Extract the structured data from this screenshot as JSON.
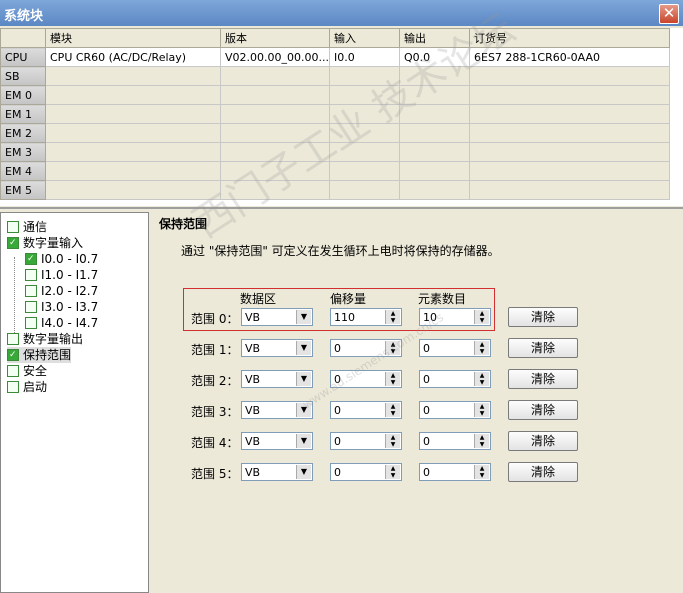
{
  "window": {
    "title": "系统块",
    "close_glyph": "✕"
  },
  "grid": {
    "headers": [
      "",
      "模块",
      "版本",
      "输入",
      "输出",
      "订货号"
    ],
    "rows": [
      {
        "label": "CPU",
        "module": "CPU CR60 (AC/DC/Relay)",
        "version": "V02.00.00_00.00...",
        "input": "I0.0",
        "output": "Q0.0",
        "order": "6ES7 288-1CR60-0AA0"
      },
      {
        "label": "SB",
        "module": "",
        "version": "",
        "input": "",
        "output": "",
        "order": ""
      },
      {
        "label": "EM 0",
        "module": "",
        "version": "",
        "input": "",
        "output": "",
        "order": ""
      },
      {
        "label": "EM 1",
        "module": "",
        "version": "",
        "input": "",
        "output": "",
        "order": ""
      },
      {
        "label": "EM 2",
        "module": "",
        "version": "",
        "input": "",
        "output": "",
        "order": ""
      },
      {
        "label": "EM 3",
        "module": "",
        "version": "",
        "input": "",
        "output": "",
        "order": ""
      },
      {
        "label": "EM 4",
        "module": "",
        "version": "",
        "input": "",
        "output": "",
        "order": ""
      },
      {
        "label": "EM 5",
        "module": "",
        "version": "",
        "input": "",
        "output": "",
        "order": ""
      }
    ]
  },
  "tree": {
    "items": [
      {
        "label": "通信",
        "checked": false,
        "level": 0
      },
      {
        "label": "数字量输入",
        "checked": true,
        "level": 0
      },
      {
        "label": "I0.0 - I0.7",
        "checked": true,
        "level": 1
      },
      {
        "label": "I1.0 - I1.7",
        "checked": false,
        "level": 1
      },
      {
        "label": "I2.0 - I2.7",
        "checked": false,
        "level": 1
      },
      {
        "label": "I3.0 - I3.7",
        "checked": false,
        "level": 1
      },
      {
        "label": "I4.0 - I4.7",
        "checked": false,
        "level": 1
      },
      {
        "label": "数字量输出",
        "checked": false,
        "level": 0
      },
      {
        "label": "保持范围",
        "checked": true,
        "level": 0,
        "selected": true
      },
      {
        "label": "安全",
        "checked": false,
        "level": 0
      },
      {
        "label": "启动",
        "checked": false,
        "level": 0
      }
    ]
  },
  "panel": {
    "heading": "保持范围",
    "description": "通过 \"保持范围\" 可定义在发生循环上电时将保持的存储器。",
    "col_area": "数据区",
    "col_offset": "偏移量",
    "col_count": "元素数目",
    "clear_label": "清除",
    "ranges": [
      {
        "label": "范围 0：",
        "area": "VB",
        "offset": "110",
        "count": "10"
      },
      {
        "label": "范围 1：",
        "area": "VB",
        "offset": "0",
        "count": "0"
      },
      {
        "label": "范围 2：",
        "area": "VB",
        "offset": "0",
        "count": "0"
      },
      {
        "label": "范围 3：",
        "area": "VB",
        "offset": "0",
        "count": "0"
      },
      {
        "label": "范围 4：",
        "area": "VB",
        "offset": "0",
        "count": "0"
      },
      {
        "label": "范围 5：",
        "area": "VB",
        "offset": "0",
        "count": "0"
      }
    ]
  },
  "watermark": {
    "text": "西门子工业 技术论坛",
    "url": "www.ad.siemens.com.cn/cs"
  }
}
